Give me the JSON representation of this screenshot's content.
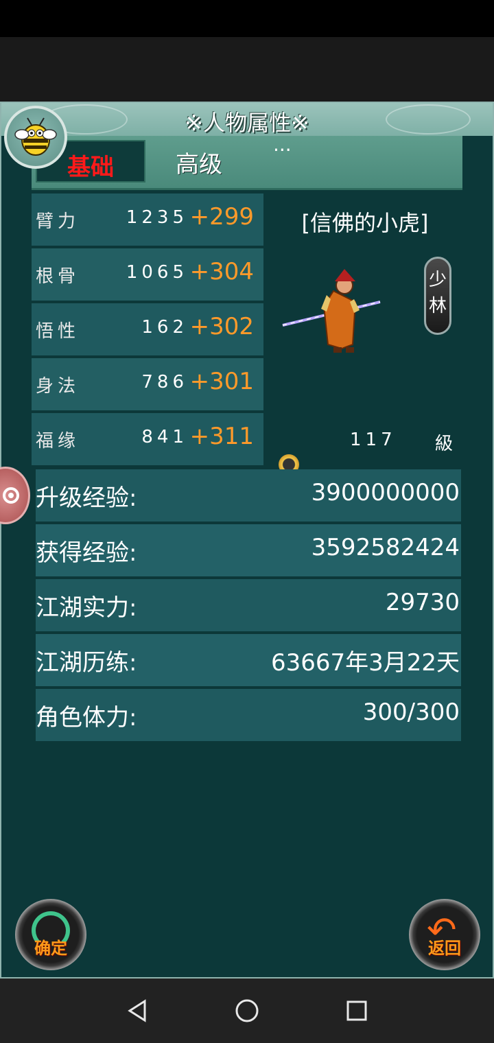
{
  "header": {
    "title": "※人物属性※"
  },
  "tabs": [
    {
      "label": "基础"
    },
    {
      "label": "高级"
    },
    {
      "label": "···"
    }
  ],
  "attributes": [
    {
      "label": "臂力",
      "value": "1235",
      "bonus": "+299"
    },
    {
      "label": "根骨",
      "value": "1065",
      "bonus": "+304"
    },
    {
      "label": "悟性",
      "value": "162",
      "bonus": "+302"
    },
    {
      "label": "身法",
      "value": "786",
      "bonus": "+301"
    },
    {
      "label": "福缘",
      "value": "841",
      "bonus": "+311"
    }
  ],
  "character": {
    "name": "[信佛的小虎]",
    "sect": "少林",
    "level": "117",
    "level_unit": "級"
  },
  "info": [
    {
      "label": "升级经验:",
      "value": "3900000000"
    },
    {
      "label": "获得经验:",
      "value": "3592582424"
    },
    {
      "label": "江湖实力:",
      "value": "29730"
    },
    {
      "label": "江湖历练:",
      "value": "63667年3月22天"
    },
    {
      "label": "角色体力:",
      "value": "300/300"
    }
  ],
  "buttons": {
    "confirm": "确定",
    "back": "返回"
  },
  "colors": {
    "panel_bg": "#0c3839",
    "row_bg": "#1f5a5f",
    "bonus": "#ff9a2a",
    "active_tab": "#ff1a1a"
  },
  "icons": [
    "bee-avatar-icon",
    "gear-icon",
    "coin-icon",
    "back-arrow-icon",
    "nav-back-icon",
    "nav-home-icon",
    "nav-recents-icon"
  ]
}
